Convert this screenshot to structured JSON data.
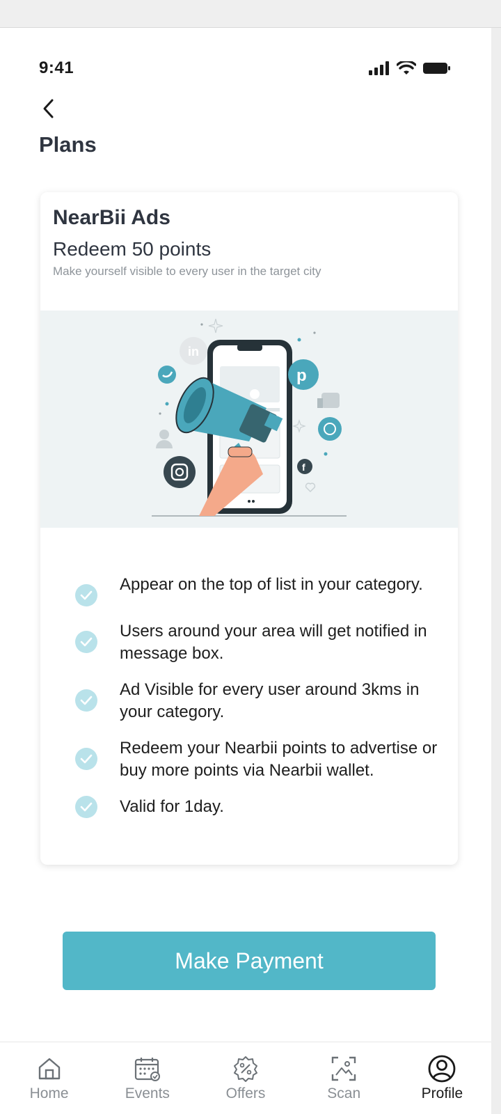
{
  "status_bar": {
    "time": "9:41"
  },
  "header": {
    "title": "Plans"
  },
  "plan": {
    "title": "NearBii Ads",
    "subtitle": "Redeem 50 points",
    "description": "Make yourself visible to every user in the target city",
    "features": [
      "Appear on the top of list in your category.",
      "Users around your area will get notified in message box.",
      "Ad Visible for every user around 3kms in your category.",
      "Redeem your Nearbii points to advertise or buy more points via Nearbii wallet.",
      "Valid for 1day."
    ]
  },
  "actions": {
    "make_payment": "Make Payment"
  },
  "bottom_nav": {
    "items": [
      {
        "label": "Home",
        "icon": "home-icon"
      },
      {
        "label": "Events",
        "icon": "calendar-icon"
      },
      {
        "label": "Offers",
        "icon": "offers-badge-icon"
      },
      {
        "label": "Scan",
        "icon": "scan-icon"
      },
      {
        "label": "Profile",
        "icon": "profile-icon",
        "active": true
      }
    ]
  },
  "colors": {
    "accent": "#52b7c8",
    "check_bg": "#b9e2ea",
    "illustration_bg": "#eef3f4"
  }
}
